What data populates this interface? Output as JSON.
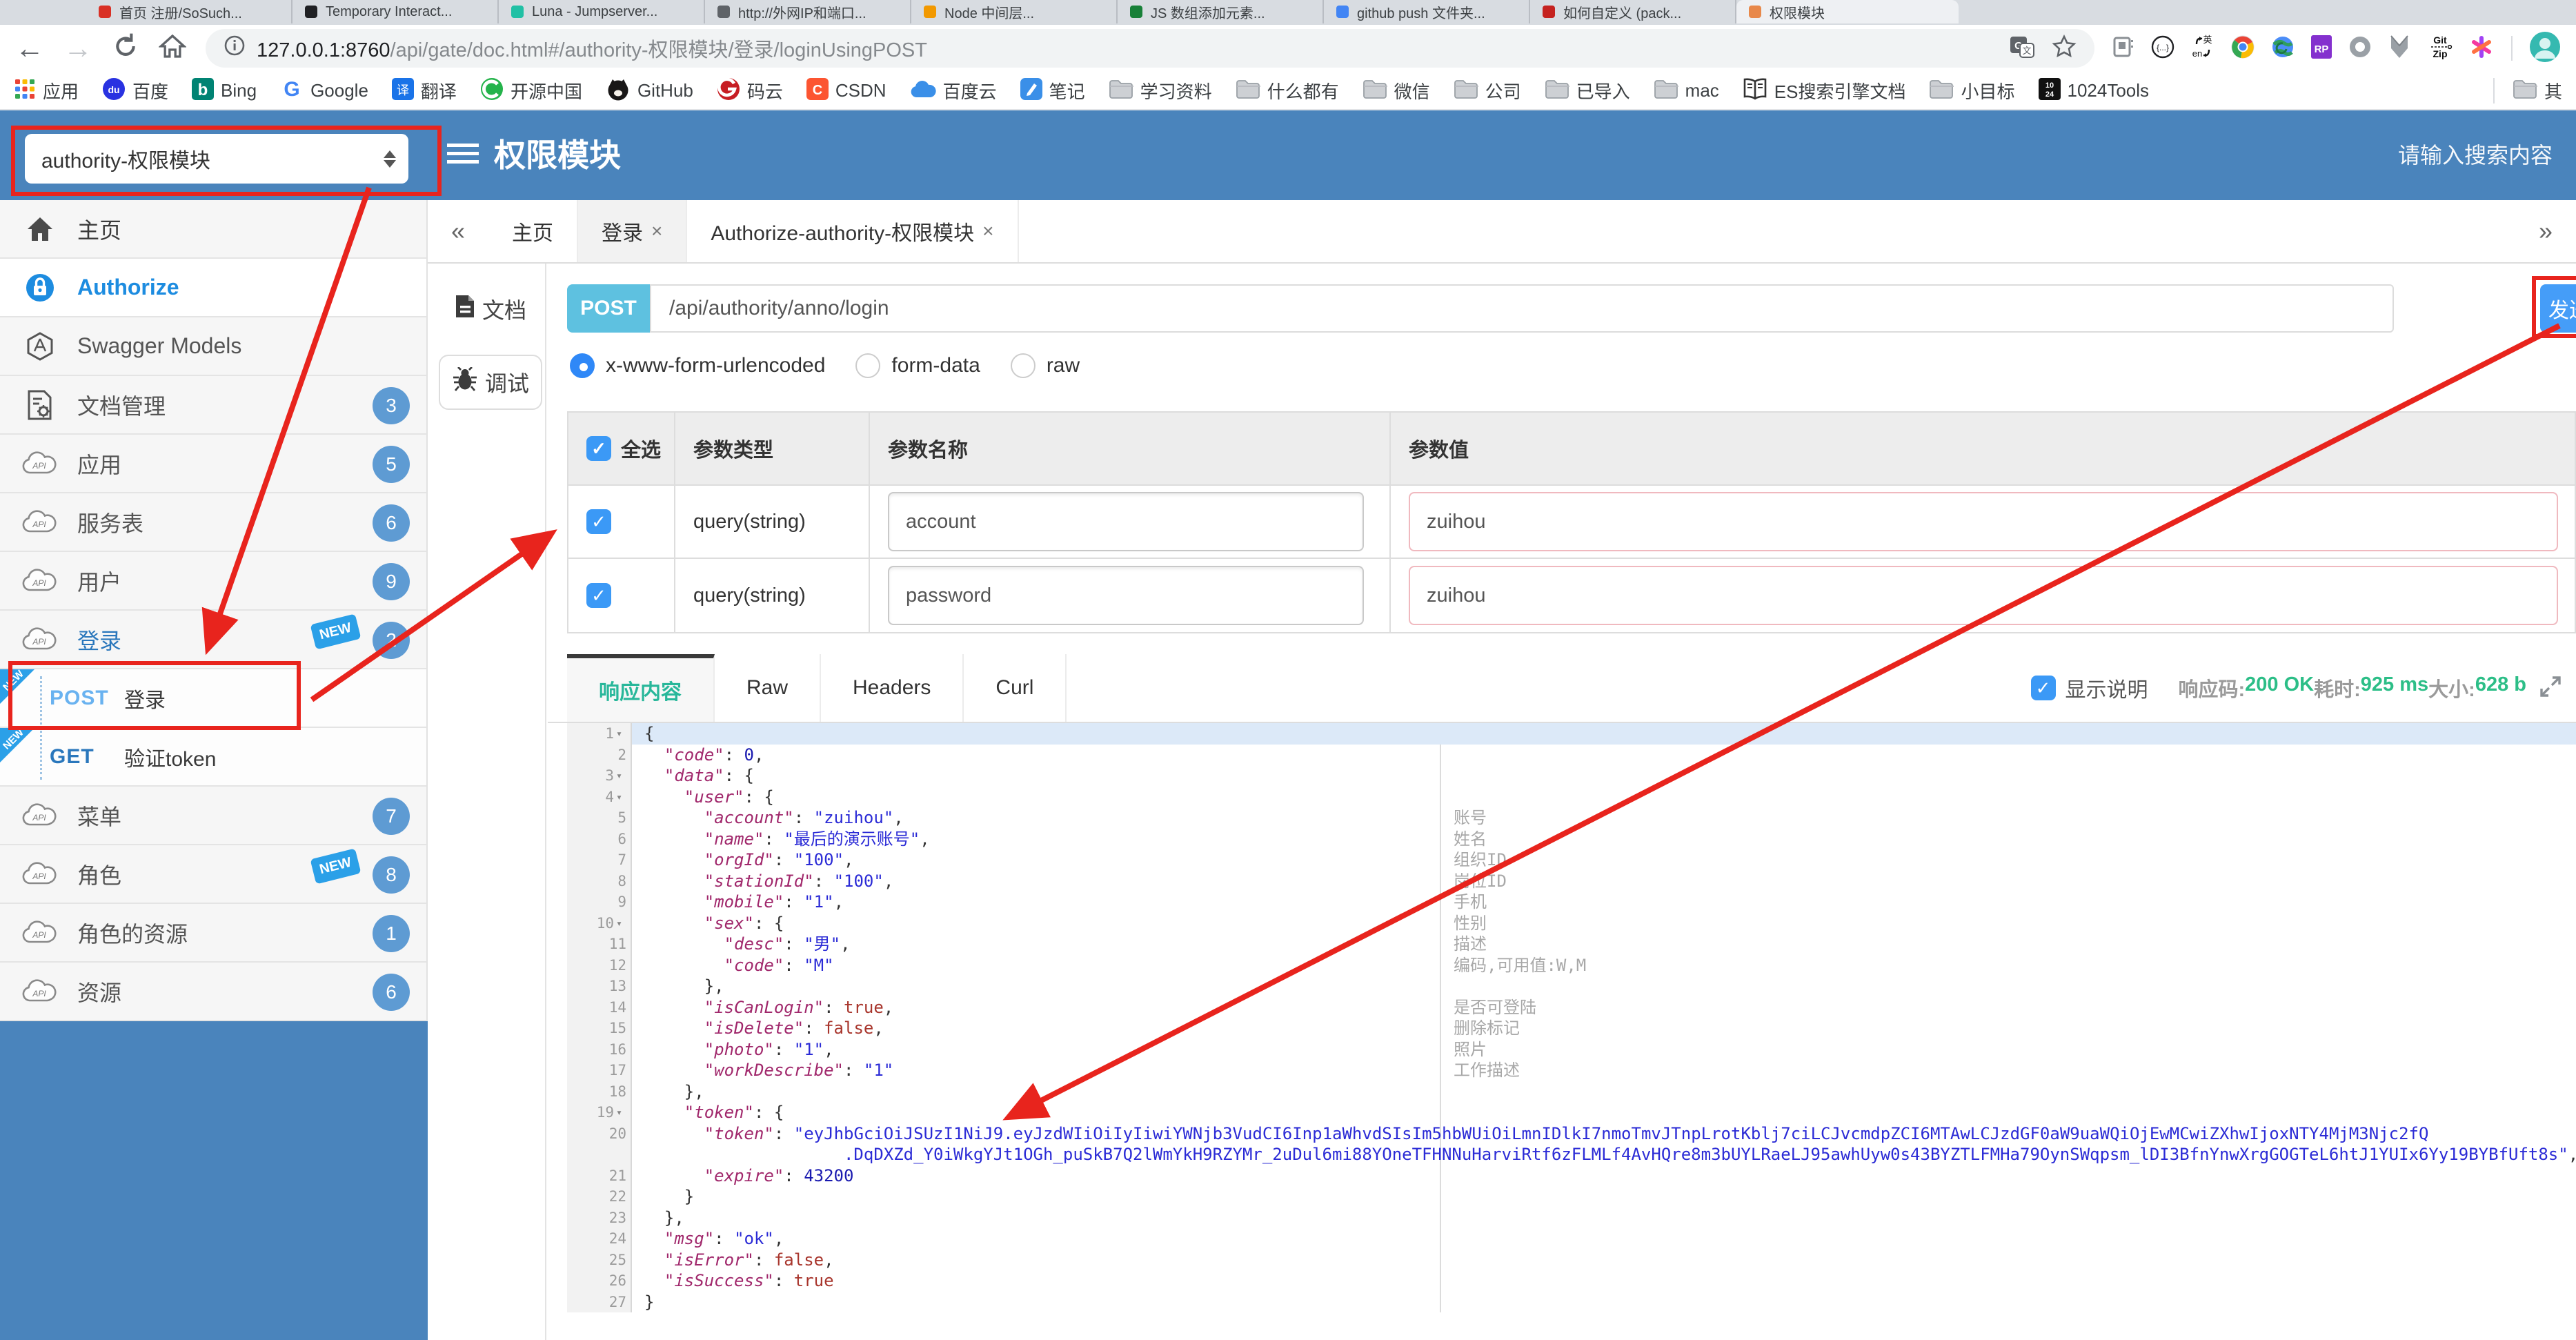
{
  "browser": {
    "tabs": [
      {
        "label": "首页 注册/SoSuch...",
        "color": "#d93025"
      },
      {
        "label": "Temporary Interact...",
        "color": "#202124"
      },
      {
        "label": "Luna - Jumpserver...",
        "color": "#21c0a5"
      },
      {
        "label": "http://外网IP和端口...",
        "color": "#5f6368"
      },
      {
        "label": "Node 中间层...",
        "color": "#f29900"
      },
      {
        "label": "JS 数组添加元素...",
        "color": "#188038"
      },
      {
        "label": "github push 文件夹...",
        "color": "#4285f4"
      },
      {
        "label": "如何自定义 (pack...",
        "color": "#c5221f"
      },
      {
        "label": "权限模块",
        "color": "#e8884a",
        "cls": "active"
      }
    ],
    "back": "←",
    "forward": "→",
    "url_host": "127.0.0.1:8760",
    "url_path": "/api/gate/doc.html#/authority-权限模块/登录/loginUsingPOST",
    "ext_icons": [
      {
        "icon": "ext-box-icon"
      },
      {
        "icon": "ext-braces-icon"
      },
      {
        "icon": "ext-en-icon"
      },
      {
        "icon": "ext-chrome-icon"
      },
      {
        "icon": "ext-globe-icon"
      },
      {
        "icon": "ext-rp-icon"
      },
      {
        "icon": "ext-o-icon"
      },
      {
        "icon": "ext-m-icon"
      },
      {
        "icon": "ext-gitzip-icon"
      },
      {
        "icon": "ext-keep-icon"
      }
    ],
    "bookmarks": [
      {
        "icon": "grid-icon",
        "label": "应用"
      },
      {
        "icon": "baidu-icon",
        "label": "百度"
      },
      {
        "icon": "bing-icon",
        "label": "Bing"
      },
      {
        "icon": "google-icon",
        "label": "Google"
      },
      {
        "icon": "translate-icon",
        "label": "翻译"
      },
      {
        "icon": "osc-icon",
        "label": "开源中国"
      },
      {
        "icon": "github-icon",
        "label": "GitHub"
      },
      {
        "icon": "gitee-icon",
        "label": "码云"
      },
      {
        "icon": "csdn-icon",
        "label": "CSDN"
      },
      {
        "icon": "baidu-cloud-icon",
        "label": "百度云"
      },
      {
        "icon": "note-icon",
        "label": "笔记"
      },
      {
        "icon": "folder-icon",
        "label": "学习资料"
      },
      {
        "icon": "folder-icon",
        "label": "什么都有"
      },
      {
        "icon": "folder-icon",
        "label": "微信"
      },
      {
        "icon": "folder-icon",
        "label": "公司"
      },
      {
        "icon": "folder-icon",
        "label": "已导入"
      },
      {
        "icon": "folder-icon",
        "label": "mac"
      },
      {
        "icon": "book-icon",
        "label": "ES搜索引擎文档"
      },
      {
        "icon": "folder-icon",
        "label": "小目标"
      },
      {
        "icon": "1024-icon",
        "label": "1024Tools"
      }
    ],
    "bookmarks_right": {
      "icon": "folder-icon",
      "label": "其"
    }
  },
  "header": {
    "module_select": "authority-权限模块",
    "title": "权限模块",
    "search_placeholder": "请输入搜索内容"
  },
  "sidebar": {
    "items": [
      {
        "icon": "home-icon",
        "label": "主页",
        "cls": "home"
      },
      {
        "icon": "lock-icon",
        "label": "Authorize",
        "cls": "authorize"
      },
      {
        "icon": "hexagon-icon",
        "label": "Swagger Models",
        "cls": ""
      },
      {
        "icon": "doc-gear-icon",
        "label": "文档管理",
        "badge": "3",
        "cls": ""
      },
      {
        "icon": "cloud-api-icon",
        "label": "应用",
        "badge": "5",
        "cls": ""
      },
      {
        "icon": "cloud-api-icon",
        "label": "服务表",
        "badge": "6",
        "cls": ""
      },
      {
        "icon": "cloud-api-icon",
        "label": "用户",
        "badge": "9",
        "cls": ""
      },
      {
        "icon": "cloud-api-icon",
        "label": "登录",
        "badge": "2",
        "ribbon": "NEW",
        "cls": "open"
      },
      {
        "method": "POST",
        "label": "登录",
        "corner": "NEW",
        "cls": "child post"
      },
      {
        "method": "GET",
        "label": "验证token",
        "corner": "NEW",
        "cls": "child get"
      },
      {
        "icon": "cloud-api-icon",
        "label": "菜单",
        "badge": "7",
        "cls": ""
      },
      {
        "icon": "cloud-api-icon",
        "label": "角色",
        "badge": "8",
        "ribbon": "NEW",
        "cls": ""
      },
      {
        "icon": "cloud-api-icon",
        "label": "角色的资源",
        "badge": "1",
        "cls": ""
      },
      {
        "icon": "cloud-api-icon",
        "label": "资源",
        "badge": "6",
        "cls": ""
      }
    ]
  },
  "tabbar": {
    "collapse": "«",
    "expand": "»",
    "tabs": [
      {
        "label": "主页",
        "cls": ""
      },
      {
        "label": "登录",
        "x": "×",
        "cls": "active"
      },
      {
        "label": "Authorize-authority-权限模块",
        "x": "×",
        "cls": ""
      }
    ]
  },
  "side_tabs": [
    {
      "icon": "doc-icon",
      "label": "文档",
      "cls": ""
    },
    {
      "icon": "bug-icon",
      "label": "调试",
      "cls": "active"
    }
  ],
  "debug": {
    "method": "POST",
    "url": "/api/authority/anno/login",
    "send_label": "发送",
    "content_types": [
      {
        "label": "x-www-form-urlencoded",
        "cls": "checked"
      },
      {
        "label": "form-data",
        "cls": ""
      },
      {
        "label": "raw",
        "cls": ""
      }
    ],
    "check_glyph": "✓",
    "table": {
      "select_all": "全选",
      "col_type": "参数类型",
      "col_name": "参数名称",
      "col_value": "参数值",
      "rows": [
        {
          "type": "query(string)",
          "name": "account",
          "value": "zuihou"
        },
        {
          "type": "query(string)",
          "name": "password",
          "value": "zuihou"
        }
      ]
    },
    "response": {
      "tabs": [
        {
          "label": "响应内容",
          "cls": "active"
        },
        {
          "label": "Raw",
          "cls": ""
        },
        {
          "label": "Headers",
          "cls": ""
        },
        {
          "label": "Curl",
          "cls": ""
        }
      ],
      "desc_label": "显示说明",
      "status": [
        {
          "label": "响应码:",
          "value": "200 OK"
        },
        {
          "label": "耗时:",
          "value": "925 ms"
        },
        {
          "label": "大小:",
          "value": "628 b"
        }
      ]
    }
  },
  "response_body": {
    "lines": [
      {
        "n": "1",
        "fold": "▾",
        "cls": "hl",
        "seg": [
          {
            "c": "p",
            "v": "{"
          }
        ]
      },
      {
        "n": "2",
        "seg": [
          {
            "c": "p",
            "v": "  "
          },
          {
            "c": "k",
            "v": "\"code\""
          },
          {
            "c": "p",
            "v": ": "
          },
          {
            "c": "n",
            "v": "0"
          },
          {
            "c": "p",
            "v": ","
          }
        ]
      },
      {
        "n": "3",
        "fold": "▾",
        "seg": [
          {
            "c": "p",
            "v": "  "
          },
          {
            "c": "k",
            "v": "\"data\""
          },
          {
            "c": "p",
            "v": ": {"
          }
        ]
      },
      {
        "n": "4",
        "fold": "▾",
        "seg": [
          {
            "c": "p",
            "v": "    "
          },
          {
            "c": "k",
            "v": "\"user\""
          },
          {
            "c": "p",
            "v": ": {"
          }
        ]
      },
      {
        "n": "5",
        "ann": "账号",
        "seg": [
          {
            "c": "p",
            "v": "      "
          },
          {
            "c": "k",
            "v": "\"account\""
          },
          {
            "c": "p",
            "v": ": "
          },
          {
            "c": "s",
            "v": "\"zuihou\""
          },
          {
            "c": "p",
            "v": ","
          }
        ]
      },
      {
        "n": "6",
        "ann": "姓名",
        "seg": [
          {
            "c": "p",
            "v": "      "
          },
          {
            "c": "k",
            "v": "\"name\""
          },
          {
            "c": "p",
            "v": ": "
          },
          {
            "c": "s",
            "v": "\"最后的演示账号\""
          },
          {
            "c": "p",
            "v": ","
          }
        ]
      },
      {
        "n": "7",
        "ann": "组织ID",
        "seg": [
          {
            "c": "p",
            "v": "      "
          },
          {
            "c": "k",
            "v": "\"orgId\""
          },
          {
            "c": "p",
            "v": ": "
          },
          {
            "c": "s",
            "v": "\"100\""
          },
          {
            "c": "p",
            "v": ","
          }
        ]
      },
      {
        "n": "8",
        "ann": "岗位ID",
        "seg": [
          {
            "c": "p",
            "v": "      "
          },
          {
            "c": "k",
            "v": "\"stationId\""
          },
          {
            "c": "p",
            "v": ": "
          },
          {
            "c": "s",
            "v": "\"100\""
          },
          {
            "c": "p",
            "v": ","
          }
        ]
      },
      {
        "n": "9",
        "ann": "手机",
        "seg": [
          {
            "c": "p",
            "v": "      "
          },
          {
            "c": "k",
            "v": "\"mobile\""
          },
          {
            "c": "p",
            "v": ": "
          },
          {
            "c": "s",
            "v": "\"1\""
          },
          {
            "c": "p",
            "v": ","
          }
        ]
      },
      {
        "n": "10",
        "fold": "▾",
        "ann": "性别",
        "seg": [
          {
            "c": "p",
            "v": "      "
          },
          {
            "c": "k",
            "v": "\"sex\""
          },
          {
            "c": "p",
            "v": ": {"
          }
        ]
      },
      {
        "n": "11",
        "ann": "描述",
        "seg": [
          {
            "c": "p",
            "v": "        "
          },
          {
            "c": "k",
            "v": "\"desc\""
          },
          {
            "c": "p",
            "v": ": "
          },
          {
            "c": "s",
            "v": "\"男\""
          },
          {
            "c": "p",
            "v": ","
          }
        ]
      },
      {
        "n": "12",
        "ann": "编码,可用值:W,M",
        "seg": [
          {
            "c": "p",
            "v": "        "
          },
          {
            "c": "k",
            "v": "\"code\""
          },
          {
            "c": "p",
            "v": ": "
          },
          {
            "c": "s",
            "v": "\"M\""
          }
        ]
      },
      {
        "n": "13",
        "seg": [
          {
            "c": "p",
            "v": "      },"
          }
        ]
      },
      {
        "n": "14",
        "ann": "是否可登陆",
        "seg": [
          {
            "c": "p",
            "v": "      "
          },
          {
            "c": "k",
            "v": "\"isCanLogin\""
          },
          {
            "c": "p",
            "v": ": "
          },
          {
            "c": "b",
            "v": "true"
          },
          {
            "c": "p",
            "v": ","
          }
        ]
      },
      {
        "n": "15",
        "ann": "删除标记",
        "seg": [
          {
            "c": "p",
            "v": "      "
          },
          {
            "c": "k",
            "v": "\"isDelete\""
          },
          {
            "c": "p",
            "v": ": "
          },
          {
            "c": "b",
            "v": "false"
          },
          {
            "c": "p",
            "v": ","
          }
        ]
      },
      {
        "n": "16",
        "ann": "照片",
        "seg": [
          {
            "c": "p",
            "v": "      "
          },
          {
            "c": "k",
            "v": "\"photo\""
          },
          {
            "c": "p",
            "v": ": "
          },
          {
            "c": "s",
            "v": "\"1\""
          },
          {
            "c": "p",
            "v": ","
          }
        ]
      },
      {
        "n": "17",
        "ann": "工作描述",
        "seg": [
          {
            "c": "p",
            "v": "      "
          },
          {
            "c": "k",
            "v": "\"workDescribe\""
          },
          {
            "c": "p",
            "v": ": "
          },
          {
            "c": "s",
            "v": "\"1\""
          }
        ]
      },
      {
        "n": "18",
        "seg": [
          {
            "c": "p",
            "v": "    },"
          }
        ]
      },
      {
        "n": "19",
        "fold": "▾",
        "seg": [
          {
            "c": "p",
            "v": "    "
          },
          {
            "c": "k",
            "v": "\"token\""
          },
          {
            "c": "p",
            "v": ": {"
          }
        ]
      },
      {
        "n": "20",
        "seg": [
          {
            "c": "p",
            "v": "      "
          },
          {
            "c": "k",
            "v": "\"token\""
          },
          {
            "c": "p",
            "v": ": "
          },
          {
            "c": "s",
            "v": "\"eyJhbGciOiJSUzI1NiJ9.eyJzdWIiOiIyIiwiYWNjb3VudCI6Inp1aWhvdSIsIm5hbWUiOiLmnIDlkI7nmoTmvJTnpLrotKblj7ciLCJvcmdpZCI6MTAwLCJzdGF0aW9uaWQiOjEwMCwiZXhwIjoxNTY4MjM3Njc2fQ"
          }
        ]
      },
      {
        "n": "",
        "seg": [
          {
            "c": "p",
            "v": "                    "
          },
          {
            "c": "s",
            "v": ".DqDXZd_Y0iWkgYJt1OGh_puSkB7Q2lWmYkH9RZYMr_2uDul6mi88YOneTFHNNuHarviRtf6zFLMLf4AvHQre8m3bUYLRaeLJ95awhUyw0s43BYZTLFMHa79OynSWqpsm_lDI3BfnYnwXrgGOGTeL6htJ1YUIx6Yy19BYBfUft8s\""
          },
          {
            "c": "p",
            "v": ","
          }
        ]
      },
      {
        "n": "21",
        "seg": [
          {
            "c": "p",
            "v": "      "
          },
          {
            "c": "k",
            "v": "\"expire\""
          },
          {
            "c": "p",
            "v": ": "
          },
          {
            "c": "n",
            "v": "43200"
          }
        ]
      },
      {
        "n": "22",
        "seg": [
          {
            "c": "p",
            "v": "    }"
          }
        ]
      },
      {
        "n": "23",
        "seg": [
          {
            "c": "p",
            "v": "  },"
          }
        ]
      },
      {
        "n": "24",
        "seg": [
          {
            "c": "p",
            "v": "  "
          },
          {
            "c": "k",
            "v": "\"msg\""
          },
          {
            "c": "p",
            "v": ": "
          },
          {
            "c": "s",
            "v": "\"ok\""
          },
          {
            "c": "p",
            "v": ","
          }
        ]
      },
      {
        "n": "25",
        "seg": [
          {
            "c": "p",
            "v": "  "
          },
          {
            "c": "k",
            "v": "\"isError\""
          },
          {
            "c": "p",
            "v": ": "
          },
          {
            "c": "b",
            "v": "false"
          },
          {
            "c": "p",
            "v": ","
          }
        ]
      },
      {
        "n": "26",
        "seg": [
          {
            "c": "p",
            "v": "  "
          },
          {
            "c": "k",
            "v": "\"isSuccess\""
          },
          {
            "c": "p",
            "v": ": "
          },
          {
            "c": "b",
            "v": "true"
          }
        ]
      },
      {
        "n": "27",
        "seg": [
          {
            "c": "p",
            "v": "}"
          }
        ]
      }
    ]
  }
}
